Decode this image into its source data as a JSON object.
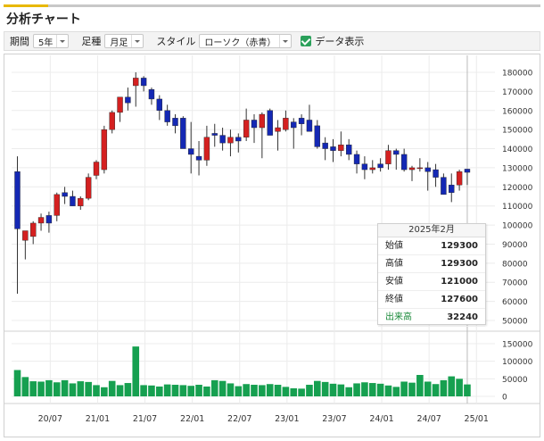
{
  "header": {
    "title": "分析チャート"
  },
  "controls": {
    "period_label": "期間",
    "period_value": "5年",
    "interval_label": "足種",
    "interval_value": "月足",
    "style_label": "スタイル",
    "style_value": "ローソク（赤青）",
    "data_label": "データ表示",
    "data_checked": true
  },
  "colors": {
    "up": "#d42020",
    "down": "#1428b4",
    "volume": "#16a050",
    "accent": "#e8b800"
  },
  "tooltip": {
    "date": "2025年2月",
    "open_label": "始値",
    "open": "129300",
    "high_label": "高値",
    "high": "129300",
    "low_label": "安値",
    "low": "121000",
    "close_label": "終値",
    "close": "127600",
    "volume_label": "出来高",
    "volume": "32240"
  },
  "chart_data": {
    "type": "candlestick",
    "y_ticks": [
      "180000",
      "170000",
      "160000",
      "150000",
      "140000",
      "130000",
      "120000",
      "110000",
      "100000",
      "90000",
      "80000",
      "70000",
      "60000",
      "50000"
    ],
    "volume_ticks": [
      "150000",
      "100000",
      "50000",
      "0"
    ],
    "x_ticks": [
      "20/07",
      "21/01",
      "21/07",
      "22/01",
      "22/07",
      "23/01",
      "23/07",
      "24/01",
      "24/07",
      "25/01"
    ],
    "ylim": [
      50000,
      180000
    ],
    "volume_ylim": [
      0,
      150000
    ],
    "grid": true,
    "candles": [
      [
        128000,
        136000,
        64000,
        98000
      ],
      [
        92000,
        96000,
        82000,
        97000
      ],
      [
        94000,
        102000,
        90000,
        101000
      ],
      [
        101000,
        106000,
        97000,
        104000
      ],
      [
        105000,
        107000,
        96000,
        101000
      ],
      [
        105000,
        117000,
        102000,
        116000
      ],
      [
        117000,
        120000,
        111000,
        115000
      ],
      [
        115000,
        118000,
        110000,
        110000
      ],
      [
        110000,
        115000,
        108000,
        114000
      ],
      [
        114000,
        127000,
        113000,
        125000
      ],
      [
        126000,
        134000,
        124000,
        133000
      ],
      [
        129000,
        152000,
        127000,
        150000
      ],
      [
        150000,
        160000,
        148000,
        159000
      ],
      [
        159000,
        166000,
        154000,
        167000
      ],
      [
        167000,
        172000,
        160000,
        164000
      ],
      [
        173000,
        180000,
        162000,
        177000
      ],
      [
        177000,
        178000,
        170000,
        173000
      ],
      [
        171000,
        172000,
        163000,
        166000
      ],
      [
        166000,
        168000,
        155000,
        160000
      ],
      [
        160000,
        163000,
        152000,
        154000
      ],
      [
        156000,
        158000,
        148000,
        152000
      ],
      [
        156000,
        157000,
        144000,
        140000
      ],
      [
        140000,
        154000,
        127000,
        137000
      ],
      [
        136000,
        144000,
        126000,
        134000
      ],
      [
        134000,
        152000,
        131000,
        146000
      ],
      [
        148000,
        153000,
        141000,
        147000
      ],
      [
        147000,
        151000,
        139000,
        143000
      ],
      [
        143000,
        150000,
        136000,
        146000
      ],
      [
        146000,
        148000,
        138000,
        144000
      ],
      [
        146000,
        161000,
        144000,
        155000
      ],
      [
        155000,
        158000,
        143000,
        151000
      ],
      [
        151000,
        159000,
        135000,
        158000
      ],
      [
        160000,
        161000,
        147000,
        147000
      ],
      [
        149000,
        155000,
        139000,
        151000
      ],
      [
        150000,
        160000,
        149000,
        156000
      ],
      [
        154000,
        156000,
        140000,
        151000
      ],
      [
        156000,
        158000,
        147000,
        153000
      ],
      [
        155000,
        163000,
        150000,
        149000
      ],
      [
        152000,
        155000,
        140000,
        141000
      ],
      [
        143000,
        146000,
        134000,
        140000
      ],
      [
        141000,
        145000,
        133000,
        139000
      ],
      [
        139000,
        149000,
        136000,
        142000
      ],
      [
        142000,
        145000,
        134000,
        137000
      ],
      [
        137000,
        139000,
        127000,
        132000
      ],
      [
        132000,
        136000,
        124000,
        129000
      ],
      [
        129000,
        134000,
        127000,
        130000
      ],
      [
        132000,
        135000,
        128000,
        130000
      ],
      [
        132000,
        142000,
        129000,
        139000
      ],
      [
        139000,
        140000,
        129000,
        137000
      ],
      [
        137000,
        140000,
        128000,
        129000
      ],
      [
        129000,
        131000,
        123000,
        130000
      ],
      [
        130000,
        135000,
        128000,
        130000
      ],
      [
        130000,
        133000,
        118000,
        128000
      ],
      [
        129000,
        132000,
        120000,
        125000
      ],
      [
        125000,
        127000,
        116000,
        116000
      ],
      [
        121000,
        127000,
        112000,
        117000
      ],
      [
        121000,
        129000,
        118000,
        128000
      ],
      [
        129300,
        129300,
        121000,
        127600
      ]
    ],
    "volumes": [
      75000,
      55000,
      43000,
      42000,
      46000,
      40000,
      46000,
      37000,
      43000,
      41000,
      32000,
      26000,
      44000,
      32000,
      38000,
      142000,
      32000,
      31000,
      28000,
      34000,
      33000,
      32000,
      30000,
      33000,
      28000,
      46000,
      44000,
      37000,
      29000,
      35000,
      33000,
      32000,
      35000,
      33000,
      27000,
      23000,
      22000,
      33000,
      44000,
      41000,
      36000,
      34000,
      26000,
      37000,
      40000,
      38000,
      36000,
      31000,
      27000,
      42000,
      39000,
      61000,
      42000,
      35000,
      46000,
      57000,
      50000,
      34000
    ]
  }
}
